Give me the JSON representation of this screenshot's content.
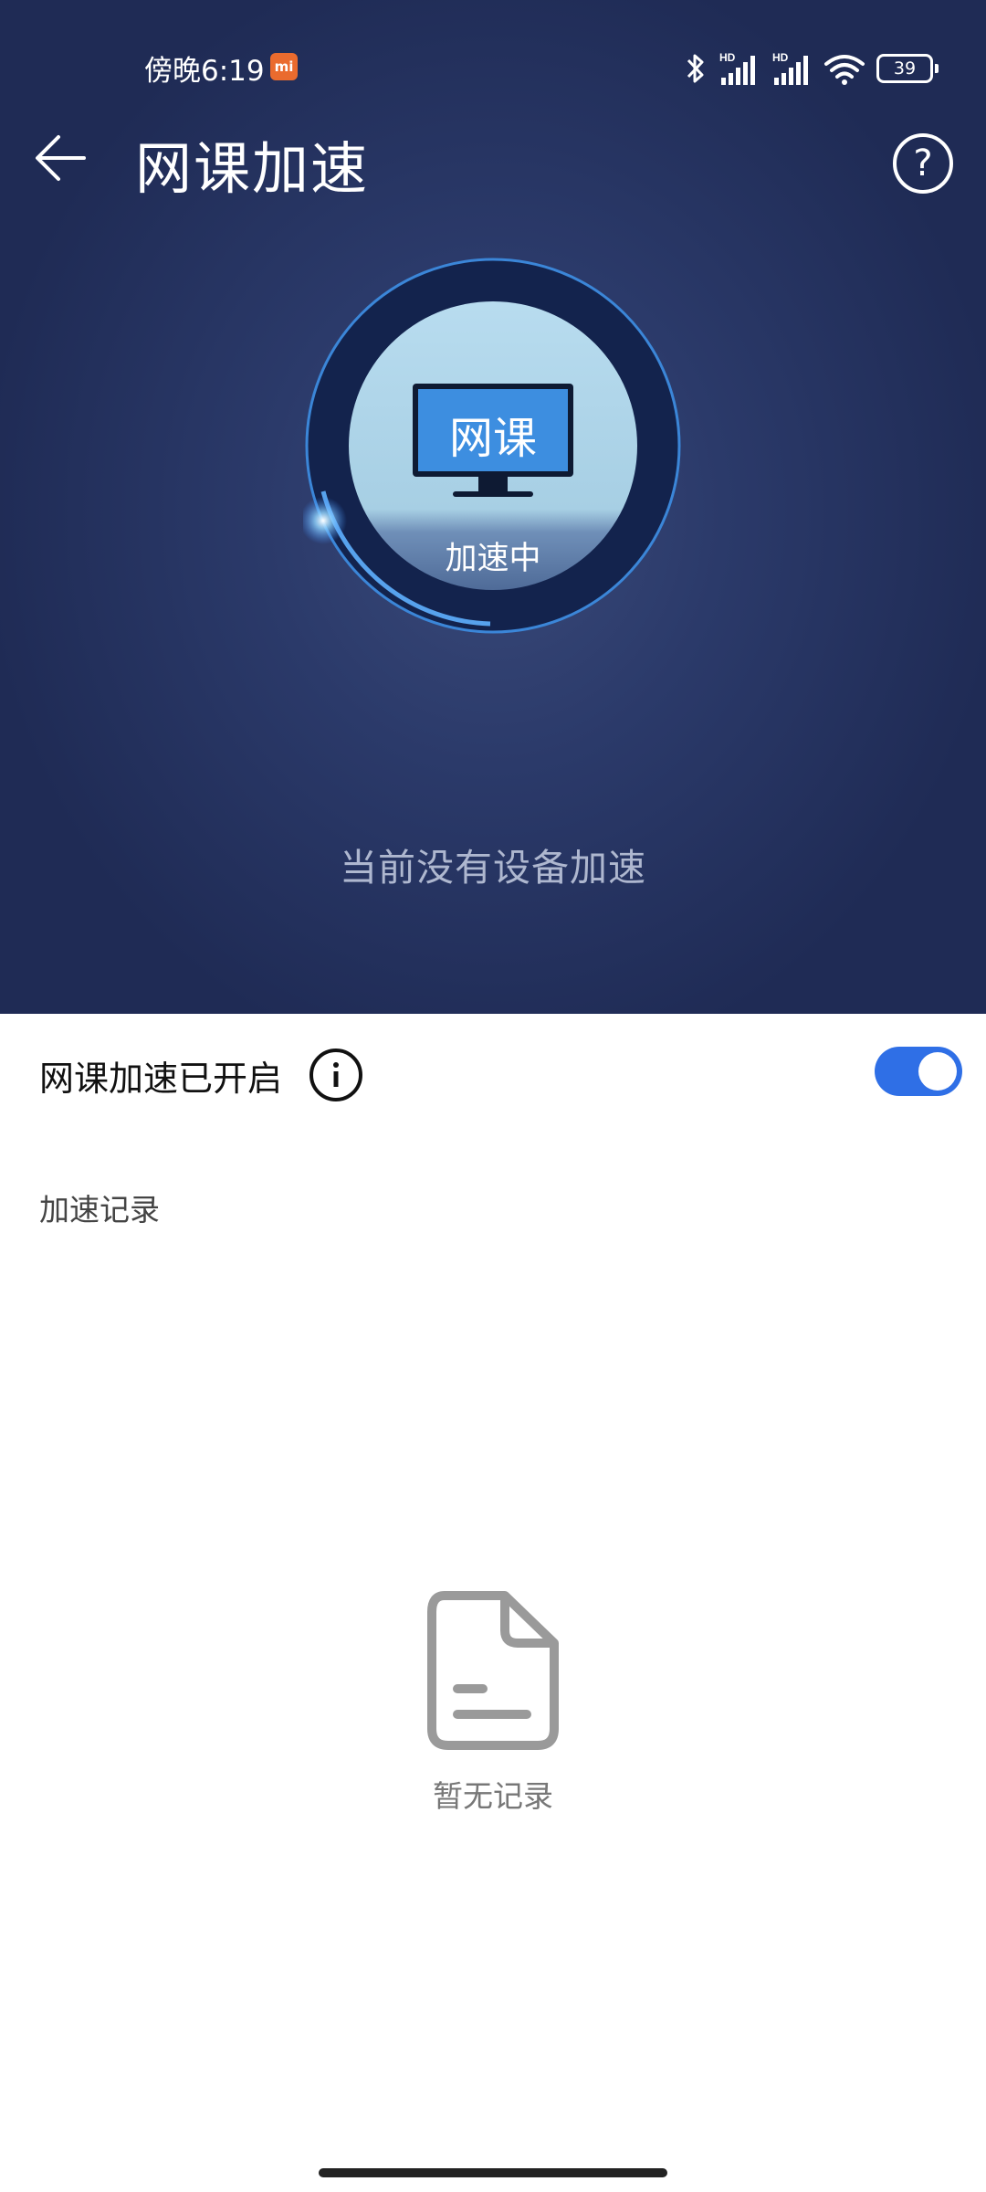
{
  "status_bar": {
    "time": "傍晚6:19",
    "carrier_badge": "mi",
    "hd1": "HD",
    "hd2": "HD",
    "battery": "39"
  },
  "header": {
    "title": "网课加速"
  },
  "dial": {
    "monitor_label": "网课",
    "status": "加速中"
  },
  "hero_message": "当前没有设备加速",
  "switch_row": {
    "label": "网课加速已开启",
    "enabled": true
  },
  "records": {
    "section_label": "加速记录",
    "empty_text": "暂无记录"
  },
  "colors": {
    "hero_background": "#2b3a6a",
    "accent": "#2f6fe6"
  }
}
